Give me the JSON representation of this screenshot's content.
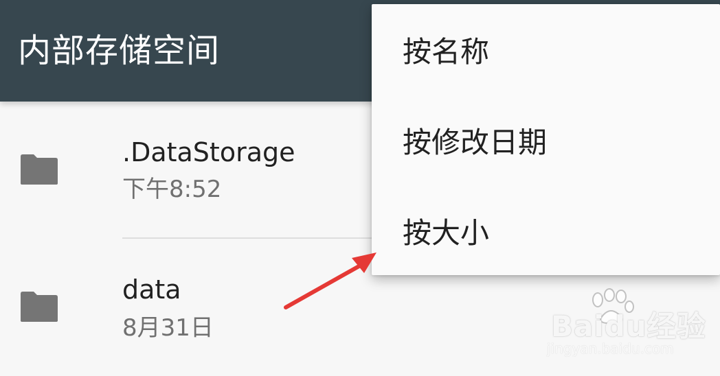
{
  "header": {
    "title": "内部存储空间"
  },
  "files": [
    {
      "name": ".DataStorage",
      "date": "下午8:52",
      "icon": "folder-icon"
    },
    {
      "name": "data",
      "date": "8月31日",
      "icon": "folder-icon"
    }
  ],
  "sort_menu": {
    "items": [
      {
        "label": "按名称"
      },
      {
        "label": "按修改日期"
      },
      {
        "label": "按大小"
      }
    ]
  },
  "annotation": {
    "arrow_color": "#e53935"
  },
  "watermark": {
    "brand": "Baidu经验",
    "url": "jingyan.baidu.com"
  },
  "colors": {
    "app_bar": "#37474f",
    "background": "#f7f7f7",
    "folder": "#757575"
  }
}
